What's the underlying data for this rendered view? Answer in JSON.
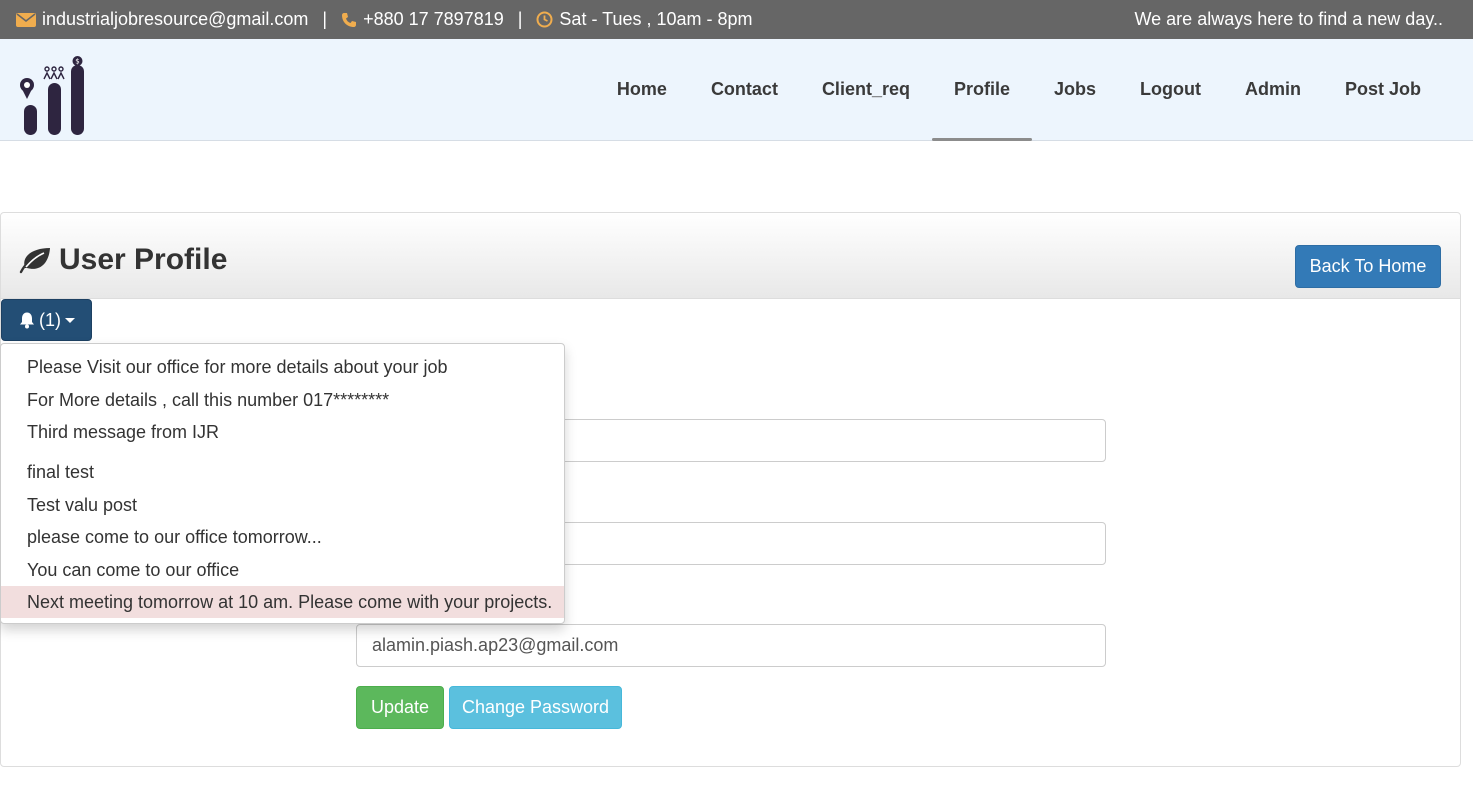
{
  "topbar": {
    "email": "industrialjobresource@gmail.com",
    "phone": "+880 17 7897819",
    "hours": "Sat - Tues , 10am - 8pm",
    "separator": "|",
    "tagline": "We are always here to find a new day..",
    "icon_color": "#f0ad4e"
  },
  "nav": {
    "items": [
      {
        "label": "Home"
      },
      {
        "label": "Contact"
      },
      {
        "label": "Client_req"
      },
      {
        "label": "Profile",
        "active": true
      },
      {
        "label": "Jobs"
      },
      {
        "label": "Logout"
      },
      {
        "label": "Admin"
      },
      {
        "label": "Post Job"
      }
    ]
  },
  "panel": {
    "title": "User Profile",
    "back_button": "Back To Home"
  },
  "notifications": {
    "button_label": "(1)",
    "items": [
      "Please Visit our office for more details about your job",
      "For More details , call this number 017********",
      "Third message from IJR",
      "final test",
      "Test valu post",
      "please come to our office tomorrow...",
      "You can come to our office",
      "Next meeting tomorrow at 10 am. Please come with your projects."
    ]
  },
  "form": {
    "field1_value": "",
    "field2_value": "",
    "email_value": "alamin.piash.ap23@gmail.com",
    "update_label": "Update",
    "change_password_label": "Change Password"
  },
  "colors": {
    "topbar_bg": "#666666",
    "header_bg": "#edf5fd",
    "primary": "#337ab7",
    "bell_button": "#234e75",
    "success": "#5cb85c",
    "info": "#5bc0de",
    "highlight": "#f2dede"
  }
}
